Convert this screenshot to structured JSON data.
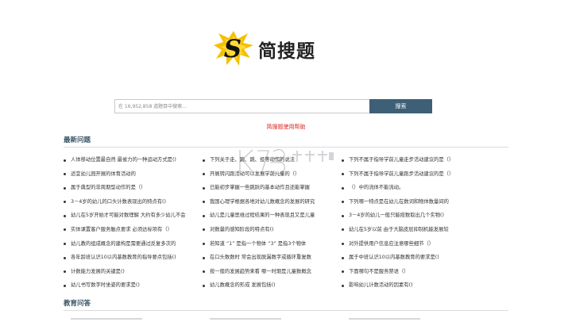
{
  "logo": {
    "text": "简搜题"
  },
  "search": {
    "placeholder": "在 16,952,858 道题目中搜索...",
    "button_label": "搜索"
  },
  "help_link": "简搜题使用帮助",
  "sections": {
    "latest": {
      "title": "最新问题",
      "columns": [
        [
          "人体移动位置最自然 最省力的一种运动方式是()",
          "适宜幼儿园开展的体育活动的",
          "属于典型的非周期型动作的是（）",
          "3－4岁的幼儿的口头计数表现出的特点有()",
          "幼儿在5岁开始才可能对数理解 大约有多少幼儿不会",
          "实体课置客户服务触点要求 必须达标项有（）",
          "幼儿教的组成概念的建构是需要通过反复多次的",
          "各年龄班认识10以内基数教育的指导要点包括()",
          "计数能力发展的关键是()",
          "幼儿书写数字时坐姿的要求是()"
        ],
        [
          "下列关于走、跑、跳、投等动作的说法",
          "开展转闪跑活动可以发展学前儿童的（）",
          "已能初步掌握一些跳跃的基本动作且还能掌握",
          "我国心理学根据各地对幼儿数概念的发展的研究",
          "幼儿是儿童思维过程结果的一种表现且又是儿童",
          "对数量的感知阶段的特点有()",
          "若知道 “1” 是指一个物体 “3” 是指3个物体",
          "在口头数数时 常会出现脱漏数字或循环重复数",
          "按一般的发展趋势来看 哪一时期是儿童数概念",
          "幼儿数概念的形成 发展包括()"
        ],
        [
          "下列不属于指导学前儿童走步活动建议的是（）",
          "下列不属于指导学前儿童跑步活动建议的是（）",
          "（）中的流体不能流动。",
          "下列哪一特点是在幼儿在数词和物体数量间的",
          "3－4岁的幼儿一般只能按数取出几个实物()",
          "幼儿在5岁以前 由于大脑皮层抑制机能发展较",
          "对外提供用户信息应注意哪些细节（）",
          "属于中班认识10以内基数教育的要求是()",
          "下面哪句不是服务禁语（）",
          "影响幼儿计数活动的因素有()"
        ]
      ]
    },
    "education": {
      "title": "教育问答"
    }
  },
  "colors": {
    "accent": "#3d6076",
    "help_link": "#e02020",
    "section_title": "#3a5566",
    "logo_yellow": "#f5c000"
  },
  "icons": {
    "logo_mark": "lightning-s-logo-icon",
    "bullet": "bullet-dot-icon",
    "watermark": "k73-watermark-icon"
  }
}
